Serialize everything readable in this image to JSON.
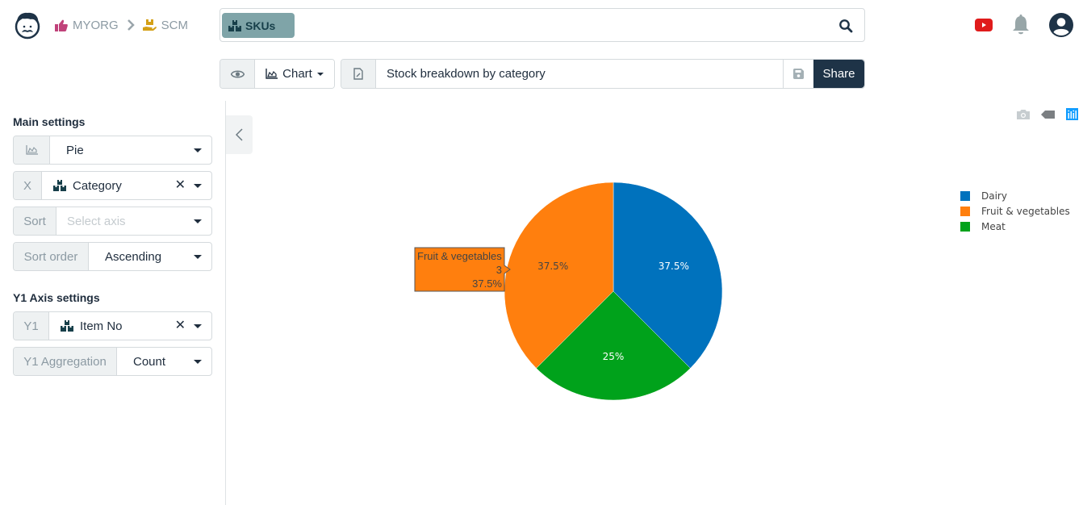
{
  "header": {
    "breadcrumb": [
      {
        "label": "MYORG",
        "icon": "thumbs-up-icon",
        "icon_color": "#c0427a"
      },
      {
        "label": "SCM",
        "icon": "hand-box-icon",
        "icon_color": "#d4a017"
      }
    ],
    "search": {
      "chip_label": "SKUs",
      "chip_icon": "boxes-icon",
      "value": ""
    },
    "icons": [
      "youtube-icon",
      "bell-icon",
      "user-icon"
    ]
  },
  "toolbar": {
    "view_mode_label": "Chart",
    "chart_title": "Stock breakdown by category",
    "share_label": "Share"
  },
  "settings": {
    "main_title": "Main settings",
    "chart_type": {
      "value": "Pie"
    },
    "x": {
      "label": "X",
      "value": "Category"
    },
    "sort": {
      "label": "Sort",
      "placeholder": "Select axis"
    },
    "sort_order": {
      "label": "Sort order",
      "value": "Ascending"
    },
    "y1_title": "Y1 Axis settings",
    "y1": {
      "label": "Y1",
      "value": "Item No"
    },
    "y1_aggregation": {
      "label": "Y1 Aggregation",
      "value": "Count"
    }
  },
  "colors": {
    "brand_dark": "#1e3347",
    "chip_bg": "#7fa4a8",
    "dairy": "#0072bd",
    "fruit": "#ff7f0e",
    "meat": "#00a21b"
  },
  "chart_data": {
    "type": "pie",
    "title": "",
    "categories": [
      "Dairy",
      "Fruit & vegetables",
      "Meat"
    ],
    "values": [
      3,
      3,
      2
    ],
    "percent_labels": [
      "37.5%",
      "37.5%",
      "25%"
    ],
    "colors": [
      "#0072bd",
      "#ff7f0e",
      "#00a21b"
    ],
    "slice_order_clockwise_from_top": [
      "Dairy",
      "Meat",
      "Fruit & vegetables"
    ],
    "legend": [
      "Dairy",
      "Fruit & vegetables",
      "Meat"
    ],
    "legend_position": "right",
    "hover_tooltip": {
      "label": "Fruit & vegetables",
      "value": "3",
      "percent": "37.5%"
    }
  }
}
